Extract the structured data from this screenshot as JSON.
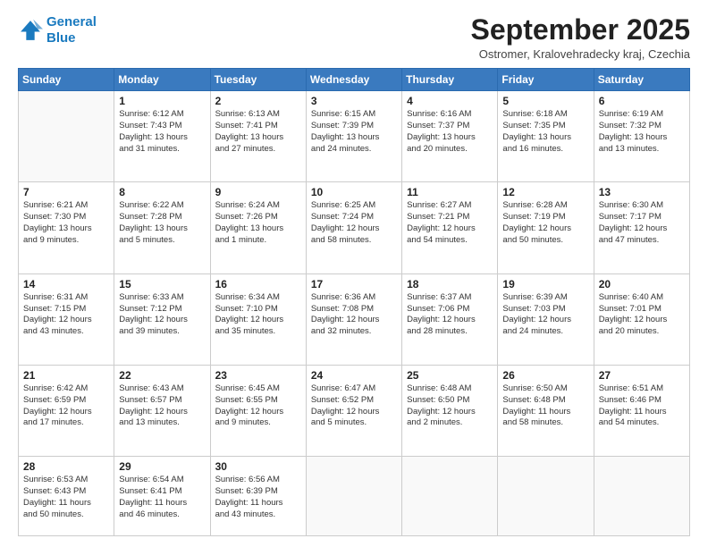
{
  "header": {
    "logo_line1": "General",
    "logo_line2": "Blue",
    "month_title": "September 2025",
    "location": "Ostromer, Kralovehradecky kraj, Czechia"
  },
  "days_of_week": [
    "Sunday",
    "Monday",
    "Tuesday",
    "Wednesday",
    "Thursday",
    "Friday",
    "Saturday"
  ],
  "weeks": [
    [
      {
        "day": "",
        "content": ""
      },
      {
        "day": "1",
        "content": "Sunrise: 6:12 AM\nSunset: 7:43 PM\nDaylight: 13 hours\nand 31 minutes."
      },
      {
        "day": "2",
        "content": "Sunrise: 6:13 AM\nSunset: 7:41 PM\nDaylight: 13 hours\nand 27 minutes."
      },
      {
        "day": "3",
        "content": "Sunrise: 6:15 AM\nSunset: 7:39 PM\nDaylight: 13 hours\nand 24 minutes."
      },
      {
        "day": "4",
        "content": "Sunrise: 6:16 AM\nSunset: 7:37 PM\nDaylight: 13 hours\nand 20 minutes."
      },
      {
        "day": "5",
        "content": "Sunrise: 6:18 AM\nSunset: 7:35 PM\nDaylight: 13 hours\nand 16 minutes."
      },
      {
        "day": "6",
        "content": "Sunrise: 6:19 AM\nSunset: 7:32 PM\nDaylight: 13 hours\nand 13 minutes."
      }
    ],
    [
      {
        "day": "7",
        "content": "Sunrise: 6:21 AM\nSunset: 7:30 PM\nDaylight: 13 hours\nand 9 minutes."
      },
      {
        "day": "8",
        "content": "Sunrise: 6:22 AM\nSunset: 7:28 PM\nDaylight: 13 hours\nand 5 minutes."
      },
      {
        "day": "9",
        "content": "Sunrise: 6:24 AM\nSunset: 7:26 PM\nDaylight: 13 hours\nand 1 minute."
      },
      {
        "day": "10",
        "content": "Sunrise: 6:25 AM\nSunset: 7:24 PM\nDaylight: 12 hours\nand 58 minutes."
      },
      {
        "day": "11",
        "content": "Sunrise: 6:27 AM\nSunset: 7:21 PM\nDaylight: 12 hours\nand 54 minutes."
      },
      {
        "day": "12",
        "content": "Sunrise: 6:28 AM\nSunset: 7:19 PM\nDaylight: 12 hours\nand 50 minutes."
      },
      {
        "day": "13",
        "content": "Sunrise: 6:30 AM\nSunset: 7:17 PM\nDaylight: 12 hours\nand 47 minutes."
      }
    ],
    [
      {
        "day": "14",
        "content": "Sunrise: 6:31 AM\nSunset: 7:15 PM\nDaylight: 12 hours\nand 43 minutes."
      },
      {
        "day": "15",
        "content": "Sunrise: 6:33 AM\nSunset: 7:12 PM\nDaylight: 12 hours\nand 39 minutes."
      },
      {
        "day": "16",
        "content": "Sunrise: 6:34 AM\nSunset: 7:10 PM\nDaylight: 12 hours\nand 35 minutes."
      },
      {
        "day": "17",
        "content": "Sunrise: 6:36 AM\nSunset: 7:08 PM\nDaylight: 12 hours\nand 32 minutes."
      },
      {
        "day": "18",
        "content": "Sunrise: 6:37 AM\nSunset: 7:06 PM\nDaylight: 12 hours\nand 28 minutes."
      },
      {
        "day": "19",
        "content": "Sunrise: 6:39 AM\nSunset: 7:03 PM\nDaylight: 12 hours\nand 24 minutes."
      },
      {
        "day": "20",
        "content": "Sunrise: 6:40 AM\nSunset: 7:01 PM\nDaylight: 12 hours\nand 20 minutes."
      }
    ],
    [
      {
        "day": "21",
        "content": "Sunrise: 6:42 AM\nSunset: 6:59 PM\nDaylight: 12 hours\nand 17 minutes."
      },
      {
        "day": "22",
        "content": "Sunrise: 6:43 AM\nSunset: 6:57 PM\nDaylight: 12 hours\nand 13 minutes."
      },
      {
        "day": "23",
        "content": "Sunrise: 6:45 AM\nSunset: 6:55 PM\nDaylight: 12 hours\nand 9 minutes."
      },
      {
        "day": "24",
        "content": "Sunrise: 6:47 AM\nSunset: 6:52 PM\nDaylight: 12 hours\nand 5 minutes."
      },
      {
        "day": "25",
        "content": "Sunrise: 6:48 AM\nSunset: 6:50 PM\nDaylight: 12 hours\nand 2 minutes."
      },
      {
        "day": "26",
        "content": "Sunrise: 6:50 AM\nSunset: 6:48 PM\nDaylight: 11 hours\nand 58 minutes."
      },
      {
        "day": "27",
        "content": "Sunrise: 6:51 AM\nSunset: 6:46 PM\nDaylight: 11 hours\nand 54 minutes."
      }
    ],
    [
      {
        "day": "28",
        "content": "Sunrise: 6:53 AM\nSunset: 6:43 PM\nDaylight: 11 hours\nand 50 minutes."
      },
      {
        "day": "29",
        "content": "Sunrise: 6:54 AM\nSunset: 6:41 PM\nDaylight: 11 hours\nand 46 minutes."
      },
      {
        "day": "30",
        "content": "Sunrise: 6:56 AM\nSunset: 6:39 PM\nDaylight: 11 hours\nand 43 minutes."
      },
      {
        "day": "",
        "content": ""
      },
      {
        "day": "",
        "content": ""
      },
      {
        "day": "",
        "content": ""
      },
      {
        "day": "",
        "content": ""
      }
    ]
  ]
}
